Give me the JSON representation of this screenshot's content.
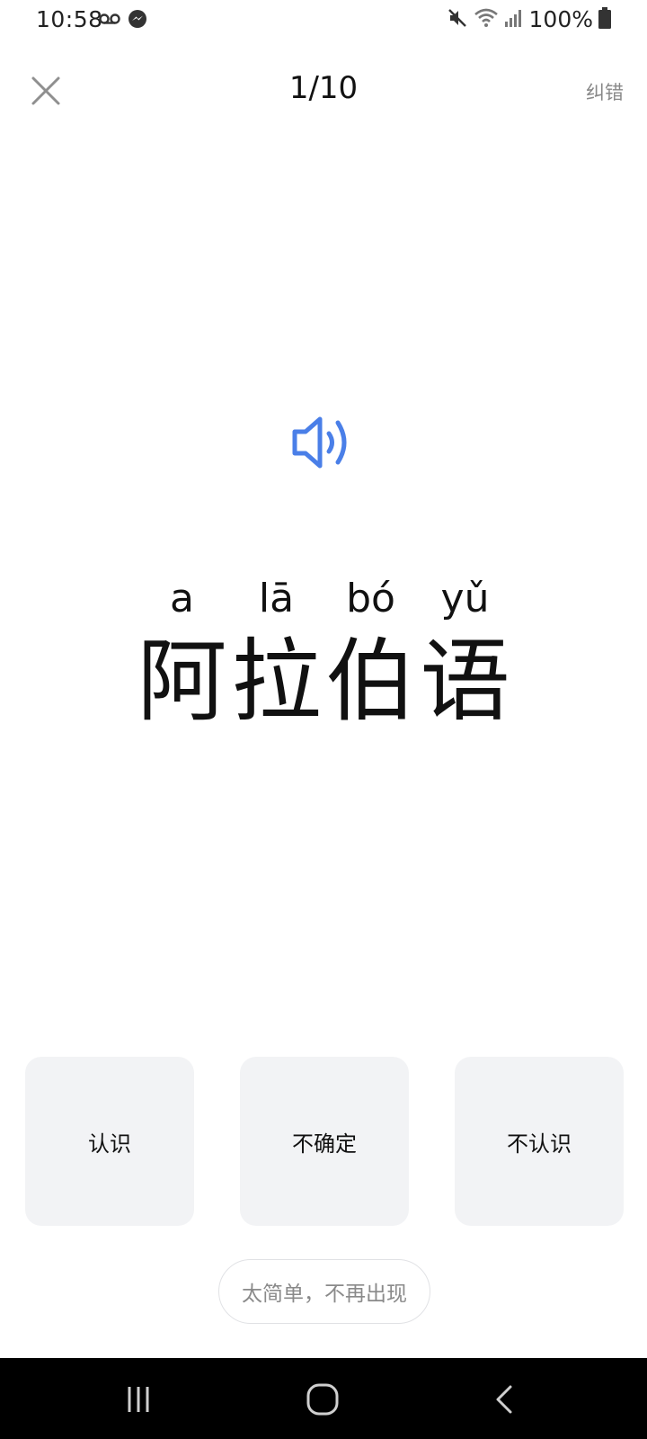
{
  "status_bar": {
    "time": "10:58",
    "battery": "100%",
    "icons": [
      "voicemail-icon",
      "messenger-icon",
      "mute-icon",
      "wifi-icon",
      "signal-icon",
      "battery-icon"
    ]
  },
  "header": {
    "progress": "1/10",
    "report_label": "纠错",
    "close_icon": "close-icon"
  },
  "word": {
    "audio_icon": "speaker-icon",
    "accent_color": "#4a7fe8",
    "pinyin": [
      "a",
      "lā",
      "bó",
      "yǔ"
    ],
    "hanzi": [
      "阿",
      "拉",
      "伯",
      "语"
    ]
  },
  "choices": {
    "know": "认识",
    "unsure": "不确定",
    "dont_know": "不认识",
    "too_easy": "太简单，不再出现"
  },
  "nav_bar": {
    "icons": [
      "recents-icon",
      "home-icon",
      "back-icon"
    ]
  }
}
